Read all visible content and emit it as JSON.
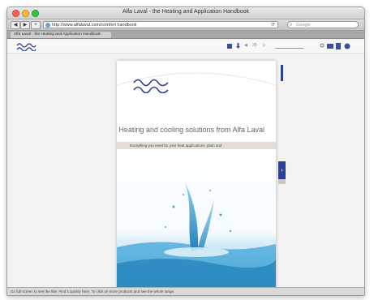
{
  "window": {
    "title": "Alfa Laval - the Heating and Application Handbook"
  },
  "addressbar": {
    "back_label": "◀",
    "forward_label": "▶",
    "add_label": "+",
    "url": "http://www.alfalaval.com/comfort handbook",
    "search_placeholder": "Google",
    "rss_label": "⟳"
  },
  "tabbar": {
    "active_tab": "Alfa Laval - the Heating and Application Handbook"
  },
  "viewer_toolbar": {
    "prev_label": "◀",
    "page_text": "25",
    "next_label": "▷"
  },
  "document": {
    "title": "Heating and cooling solutions from Alfa Laval",
    "subtitle": "Everything you need for your heat applications, plain and"
  },
  "controls": {
    "next_page_label": "›"
  },
  "statusbar": {
    "text": "Go full screen to see the title. Find it quickly here. To click on more products and see the whole range."
  },
  "colors": {
    "brand_blue": "#2a3f9b",
    "water_blue": "#2f8ec7"
  }
}
